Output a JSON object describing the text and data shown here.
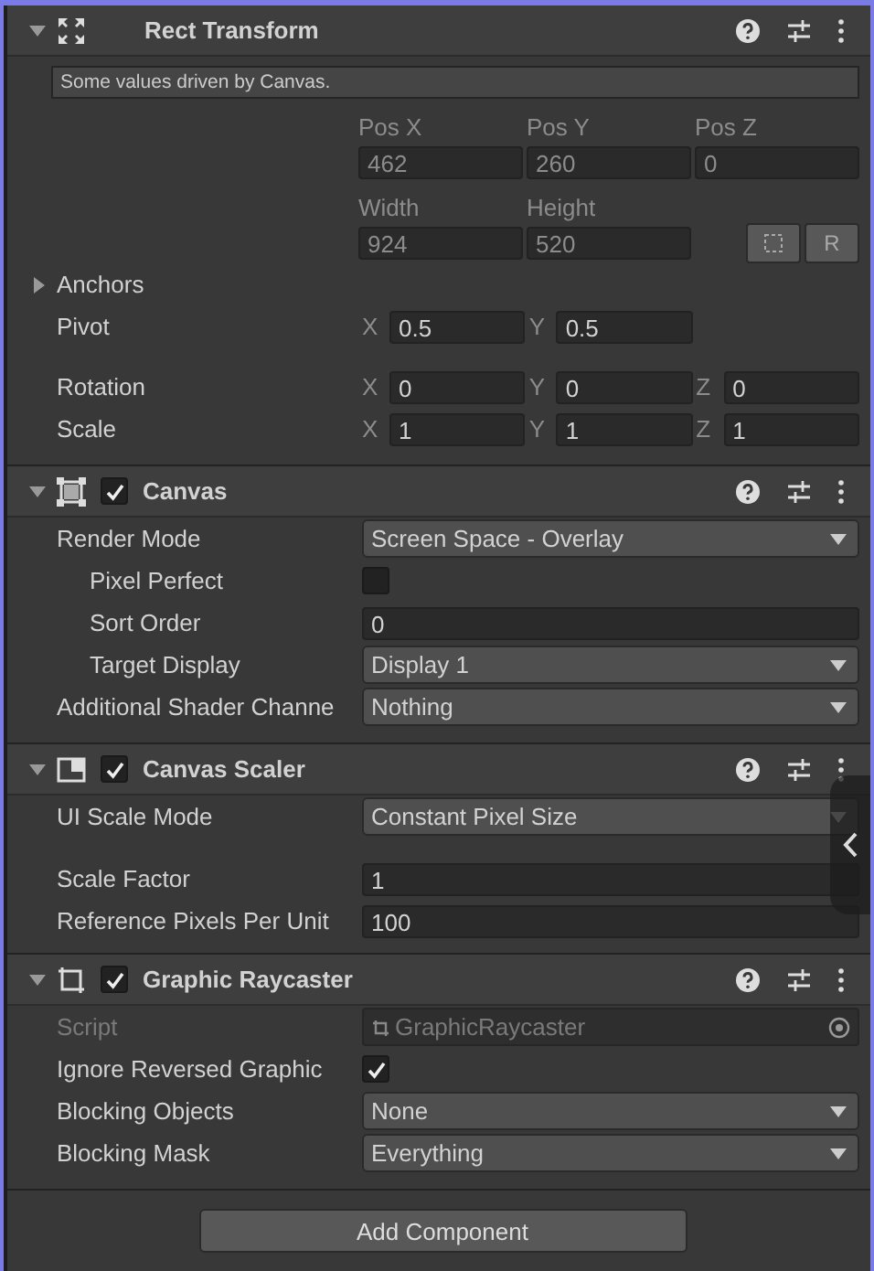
{
  "components": [
    {
      "kind": "rect_transform",
      "title": "Rect Transform",
      "expanded": true,
      "note": "Some values driven by Canvas.",
      "rows": [
        {
          "kind": "axis_labels",
          "labels": [
            "Pos X",
            "Pos Y",
            "Pos Z"
          ]
        },
        {
          "kind": "axis_values",
          "values": [
            "462",
            "260",
            "0"
          ]
        },
        {
          "kind": "axis_labels",
          "labels": [
            "Width",
            "Height"
          ]
        },
        {
          "kind": "size_values",
          "values": [
            "924",
            "520"
          ],
          "button": "R"
        },
        {
          "kind": "foldout",
          "label": "Anchors",
          "expanded": false
        },
        {
          "kind": "vector",
          "label": "Pivot",
          "fields": [
            {
              "axis": "X",
              "value": "0.5"
            },
            {
              "axis": "Y",
              "value": "0.5"
            }
          ]
        },
        {
          "kind": "vector",
          "label": "Rotation",
          "fields": [
            {
              "axis": "X",
              "value": "0"
            },
            {
              "axis": "Y",
              "value": "0"
            },
            {
              "axis": "Z",
              "value": "0"
            }
          ]
        },
        {
          "kind": "vector",
          "label": "Scale",
          "fields": [
            {
              "axis": "X",
              "value": "1"
            },
            {
              "axis": "Y",
              "value": "1"
            },
            {
              "axis": "Z",
              "value": "1"
            }
          ]
        }
      ]
    },
    {
      "kind": "canvas",
      "title": "Canvas",
      "expanded": true,
      "enabled": true,
      "rows": [
        {
          "kind": "dropdown",
          "label": "Render Mode",
          "value": "Screen Space - Overlay",
          "indented": false
        },
        {
          "kind": "checkbox",
          "label": "Pixel Perfect",
          "checked": false,
          "indented": true
        },
        {
          "kind": "number",
          "label": "Sort Order",
          "value": "0",
          "indented": true
        },
        {
          "kind": "dropdown",
          "label": "Target Display",
          "value": "Display 1",
          "indented": true
        },
        {
          "kind": "dropdown",
          "label": "Additional Shader Channe",
          "value": "Nothing",
          "indented": false
        }
      ]
    },
    {
      "kind": "canvas_scaler",
      "title": "Canvas Scaler",
      "expanded": true,
      "enabled": true,
      "rows": [
        {
          "kind": "dropdown",
          "label": "UI Scale Mode",
          "value": "Constant Pixel Size",
          "indented": false
        },
        {
          "kind": "number",
          "label": "Scale Factor",
          "value": "1",
          "indented": false
        },
        {
          "kind": "number",
          "label": "Reference Pixels Per Unit",
          "value": "100",
          "indented": false
        }
      ]
    },
    {
      "kind": "graphic_raycaster",
      "title": "Graphic Raycaster",
      "expanded": true,
      "enabled": true,
      "rows": [
        {
          "kind": "object",
          "label": "Script",
          "value": "GraphicRaycaster",
          "disabled": true
        },
        {
          "kind": "checkbox",
          "label": "Ignore Reversed Graphic",
          "checked": true,
          "indented": false
        },
        {
          "kind": "dropdown",
          "label": "Blocking Objects",
          "value": "None",
          "indented": false
        },
        {
          "kind": "dropdown",
          "label": "Blocking Mask",
          "value": "Everything",
          "indented": false
        }
      ]
    }
  ],
  "add_button": "Add Component"
}
